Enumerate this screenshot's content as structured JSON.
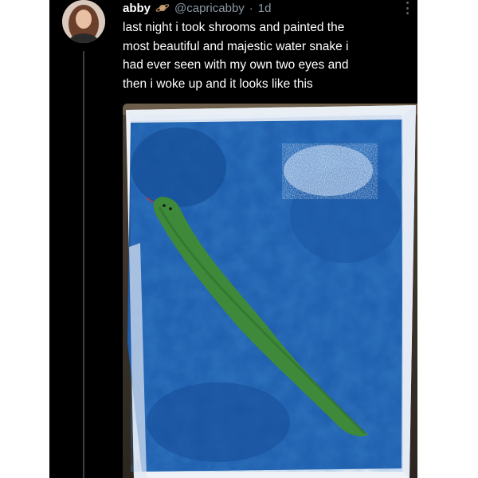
{
  "tweet": {
    "display_name": "abby",
    "badge_icon": "planet-icon",
    "handle": "@capricabby",
    "separator": "·",
    "time": "1d",
    "text_lines": [
      "last night i took shrooms and painted the",
      "most beautiful and majestic water snake i",
      "had ever seen with my own two eyes and",
      "then i woke up and it looks like this"
    ],
    "avatar_icon": "profile-photo",
    "menu_icon": "more-options-icon",
    "media_description_icon": "painting-photo"
  },
  "colors": {
    "background": "#000000",
    "text": "#ffffff",
    "secondary_text": "#8b98a5",
    "canvas_blue": "#1f5fb0",
    "snake_green": "#3e8a3a"
  }
}
